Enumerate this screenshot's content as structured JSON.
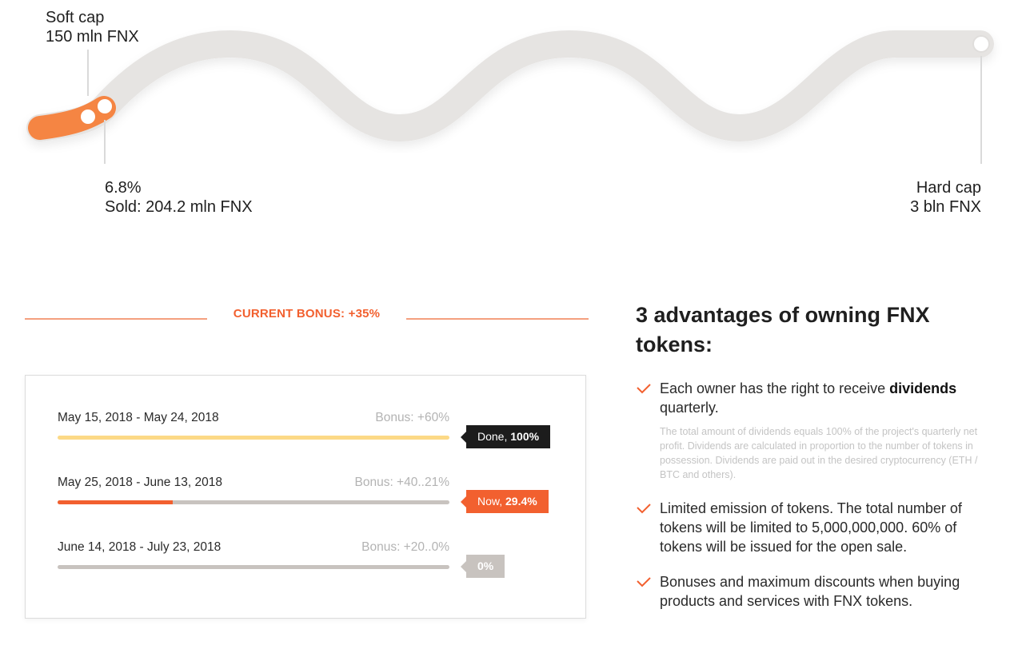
{
  "progress": {
    "soft_cap": {
      "line1": "Soft cap",
      "line2": "150 mln FNX"
    },
    "sold": {
      "percent": "6.8%",
      "amount": "Sold: 204.2 mln FNX",
      "fraction": 0.068
    },
    "hard_cap": {
      "line1": "Hard cap",
      "line2": "3 bln FNX"
    }
  },
  "bonus_section": {
    "title": "CURRENT BONUS: +35%",
    "stages": [
      {
        "dates": "May 15, 2018 - May 24, 2018",
        "bonus": "Bonus: +60%",
        "badge_prefix": "Done,",
        "badge_value": "100%",
        "progress": 1.0,
        "bar_color": "#fcd986",
        "badge_color": "#1c1c1c"
      },
      {
        "dates": "May 25, 2018 - June 13, 2018",
        "bonus": "Bonus: +40..21%",
        "badge_prefix": "Now,",
        "badge_value": "29.4%",
        "progress": 0.294,
        "bar_color": "#f2602f",
        "badge_color": "#f2602f"
      },
      {
        "dates": "June 14, 2018 - July 23, 2018",
        "bonus": "Bonus: +20..0%",
        "badge_prefix": "",
        "badge_value": "0%",
        "progress": 0.0,
        "bar_color": "#c8c3bf",
        "badge_color": "#c8c3bf"
      }
    ]
  },
  "advantages": {
    "title": "3 advantages of owning FNX tokens:",
    "item1": {
      "text_before": "Each owner has the right to receive ",
      "text_bold": "dividends",
      "text_after": " quarterly.",
      "note": "The total amount of dividends equals 100% of the project's quarterly net profit. Dividends are calculated in proportion to the number of tokens in possession. Dividends are paid out in the desired cryptocurrency (ETH / BTC and others)."
    },
    "item2": {
      "text": "Limited emission of tokens. The total number of tokens will be limited to 5,000,000,000. 60% of tokens will be issued for the open sale."
    },
    "item3": {
      "text": "Bonuses and maximum discounts when buying products and services with FNX tokens."
    }
  },
  "colors": {
    "accent": "#f2602f",
    "wave_track": "#e6e4e2",
    "wave_fill": "#f58543"
  }
}
